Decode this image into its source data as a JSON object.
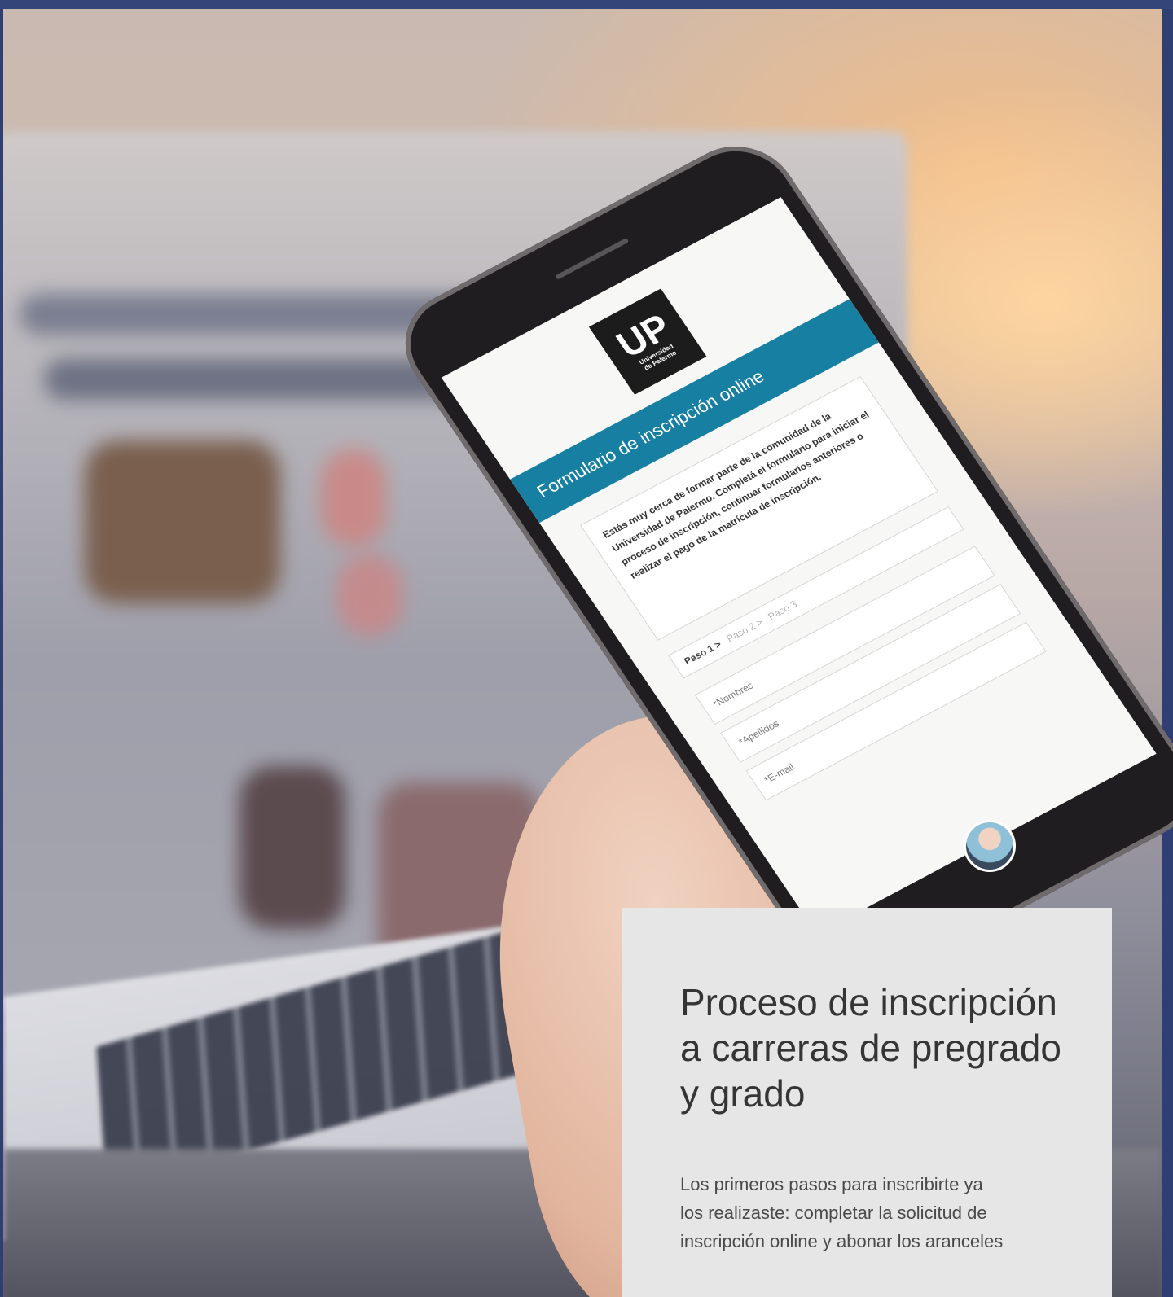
{
  "phone_form": {
    "logo_letters": "UP",
    "logo_subtitle_line1": "Universidad",
    "logo_subtitle_line2": "de Palermo",
    "header": "Formulario de inscripción online",
    "intro": "Estás muy cerca de formar parte de la comunidad de la Universidad de Palermo. Completá el formulario para iniciar el proceso de inscripción, continuar formularios anteriores o realizar el pago de la matrícula de inscripción.",
    "steps": [
      "Paso 1 >",
      "Paso 2 >",
      "Paso 3"
    ],
    "fields": [
      "*Nombres",
      "*Apellidos",
      "*E-mail"
    ]
  },
  "info_card": {
    "title_line1": "Proceso de inscripción",
    "title_line2": "a carreras de pregrado",
    "title_line3": "y grado",
    "body_line1": "Los primeros pasos para inscribirte ya",
    "body_line2": "los realizaste: completar la solicitud de",
    "body_line3": "inscripción online y abonar los aranceles"
  },
  "colors": {
    "top_bar": "#33467a",
    "form_band": "#177fa2",
    "card_bg": "#e6e6e6",
    "card_text": "#353535"
  }
}
